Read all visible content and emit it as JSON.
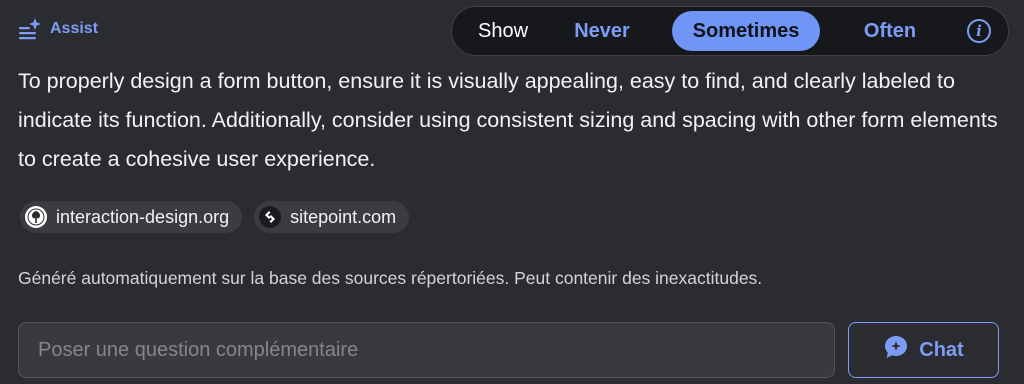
{
  "assist": {
    "label": "Assist",
    "icon": "assist-sparkle-icon"
  },
  "frequency": {
    "label": "Show",
    "options": [
      "Never",
      "Sometimes",
      "Often"
    ],
    "selected": "Sometimes",
    "info_icon": "info-icon"
  },
  "answer": {
    "text": "To properly design a form button, ensure it is visually appealing, easy to find, and clearly labeled to indicate its function. Additionally, consider using consistent sizing and spacing with other form elements to create a cohesive user experience."
  },
  "sources": [
    {
      "label": "interaction-design.org",
      "icon": "interaction-design-logo-icon"
    },
    {
      "label": "sitepoint.com",
      "icon": "sitepoint-logo-icon"
    }
  ],
  "disclaimer": "Généré automatiquement sur la base des sources répertoriées. Peut contenir des inexactitudes.",
  "followup": {
    "placeholder": "Poser une question complémentaire",
    "value": "",
    "button_label": "Chat",
    "button_icon": "chat-bubble-icon"
  },
  "colors": {
    "background": "#2b2c31",
    "accent": "#7f9cf5",
    "selected_pill": "#6f95f7",
    "toggle_bg": "#17181c",
    "chip_bg": "#3b3c42",
    "input_bg": "#393a3f"
  }
}
